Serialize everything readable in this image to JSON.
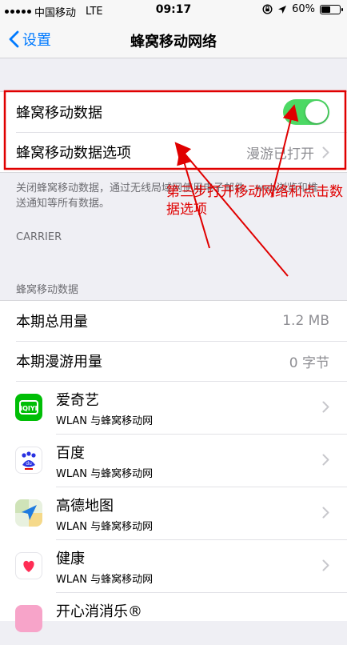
{
  "status_bar": {
    "carrier": "中国移动",
    "network": "LTE",
    "time": "09:17",
    "battery": "60%",
    "battery_level": 0.6
  },
  "nav": {
    "back_label": "设置",
    "title": "蜂窝移动网络"
  },
  "cellular_group": {
    "data_label": "蜂窝移动数据",
    "data_enabled": true,
    "options_label": "蜂窝移动数据选项",
    "options_value": "漫游已打开"
  },
  "footnote": "关闭蜂窝移动数据，通过无线局域网使用电子邮件、web浏览和推送通知等所有数据。",
  "carrier_header": "CARRIER",
  "usage_header": "蜂窝移动数据",
  "usage": {
    "current_label": "本期总用量",
    "current_value": "1.2 MB",
    "roaming_label": "本期漫游用量",
    "roaming_value": "0 字节"
  },
  "apps": [
    {
      "name": "爱奇艺",
      "sub": "WLAN 与蜂窝移动网",
      "icon": "iqiyi-icon"
    },
    {
      "name": "百度",
      "sub": "WLAN 与蜂窝移动网",
      "icon": "baidu-icon"
    },
    {
      "name": "高德地图",
      "sub": "WLAN 与蜂窝移动网",
      "icon": "amap-icon"
    },
    {
      "name": "健康",
      "sub": "WLAN 与蜂窝移动网",
      "icon": "health-icon"
    },
    {
      "name": "开心消消乐®",
      "sub": "",
      "icon": "game-icon"
    }
  ],
  "annotation": {
    "text": "第三步打开移动网络和点击数据选项",
    "color": "#e00000"
  },
  "colors": {
    "accent": "#007aff",
    "toggle_on": "#4cd964",
    "background": "#efeff4"
  }
}
